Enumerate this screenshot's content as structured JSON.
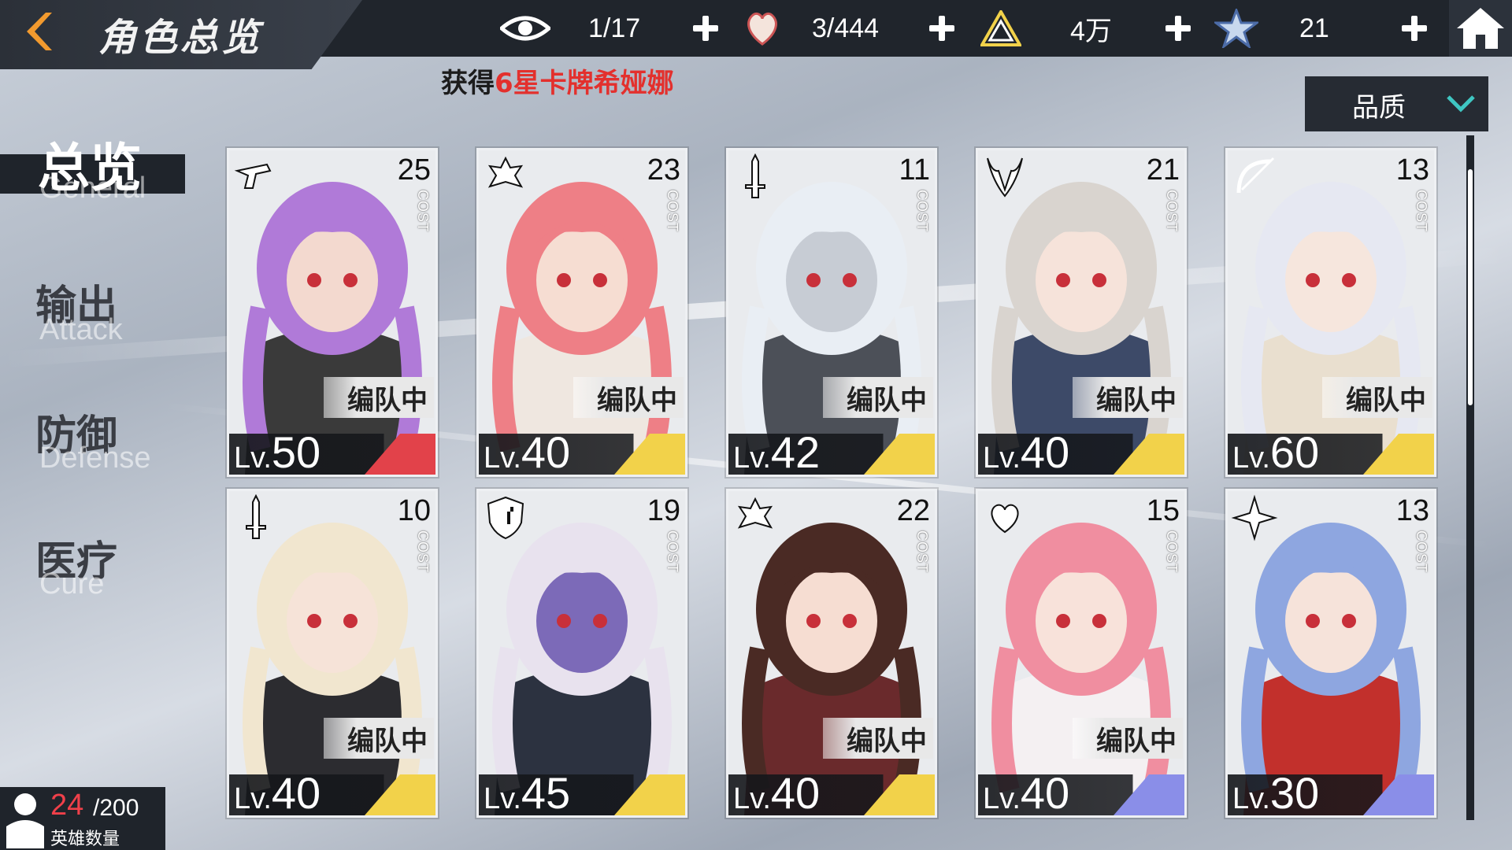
{
  "header": {
    "title": "角色总览",
    "resources": [
      {
        "icon": "eye-icon",
        "value": "1/17"
      },
      {
        "icon": "heart-hand-icon",
        "value": "3/444"
      },
      {
        "icon": "triangle-emblem-icon",
        "value": "4万"
      },
      {
        "icon": "star-crystal-icon",
        "value": "21"
      }
    ]
  },
  "notice": {
    "prefix": "获得",
    "highlight": "6星卡牌希娅娜"
  },
  "sort": {
    "label": "品质"
  },
  "tabs": [
    {
      "cn": "总览",
      "en": "General",
      "active": true
    },
    {
      "cn": "输出",
      "en": "Attack",
      "active": false
    },
    {
      "cn": "防御",
      "en": "Defense",
      "active": false
    },
    {
      "cn": "医疗",
      "en": "Cure",
      "active": false
    }
  ],
  "cost_tag": "COST",
  "lv_prefix": "Lv.",
  "team_label": "编队中",
  "cards": [
    {
      "cost": "25",
      "level": "50",
      "in_team": true,
      "class_icon": "gun-icon",
      "stripe": "#e2424a",
      "hair": "#b07ad8",
      "skin": "#f3d9cf",
      "outfit": "#3a3a3a"
    },
    {
      "cost": "23",
      "level": "40",
      "in_team": true,
      "class_icon": "crest-icon",
      "stripe": "#f2d24a",
      "hair": "#ee7f86",
      "skin": "#f6ddd2",
      "outfit": "#efe7e0"
    },
    {
      "cost": "11",
      "level": "42",
      "in_team": true,
      "class_icon": "sword-icon",
      "stripe": "#f2d24a",
      "hair": "#e9eef4",
      "skin": "#c7ccd4",
      "outfit": "#4c5058"
    },
    {
      "cost": "21",
      "level": "40",
      "in_team": true,
      "class_icon": "demon-icon",
      "stripe": "#f2d24a",
      "hair": "#d9d4cf",
      "skin": "#f6e3da",
      "outfit": "#3d4a68"
    },
    {
      "cost": "13",
      "level": "60",
      "in_team": true,
      "class_icon": "bow-icon",
      "stripe": "#f2d24a",
      "hair": "#e6e8f2",
      "skin": "#f6e6dd",
      "outfit": "#e9dfcf"
    },
    {
      "cost": "10",
      "level": "40",
      "in_team": true,
      "class_icon": "sword-icon",
      "stripe": "#f2d24a",
      "hair": "#f1e6cf",
      "skin": "#f6e3d8",
      "outfit": "#2c2c30"
    },
    {
      "cost": "19",
      "level": "45",
      "in_team": false,
      "class_icon": "shield-icon",
      "stripe": "#f2d24a",
      "hair": "#e8e2ee",
      "skin": "#7c6ab8",
      "outfit": "#2c3240"
    },
    {
      "cost": "22",
      "level": "40",
      "in_team": true,
      "class_icon": "crest-icon",
      "stripe": "#f2d24a",
      "hair": "#4a2a24",
      "skin": "#f6ddd2",
      "outfit": "#6a2a2c"
    },
    {
      "cost": "15",
      "level": "40",
      "in_team": true,
      "class_icon": "heart-wing-icon",
      "stripe": "#8a8ee8",
      "hair": "#f08ea0",
      "skin": "#f8e2da",
      "outfit": "#f4f0f2"
    },
    {
      "cost": "13",
      "level": "30",
      "in_team": false,
      "class_icon": "shuriken-icon",
      "stripe": "#8a8ee8",
      "hair": "#8ea6e0",
      "skin": "#f6e3da",
      "outfit": "#c2302c"
    }
  ],
  "hero_count": {
    "current": "24",
    "max": "/200",
    "label": "英雄数量"
  }
}
